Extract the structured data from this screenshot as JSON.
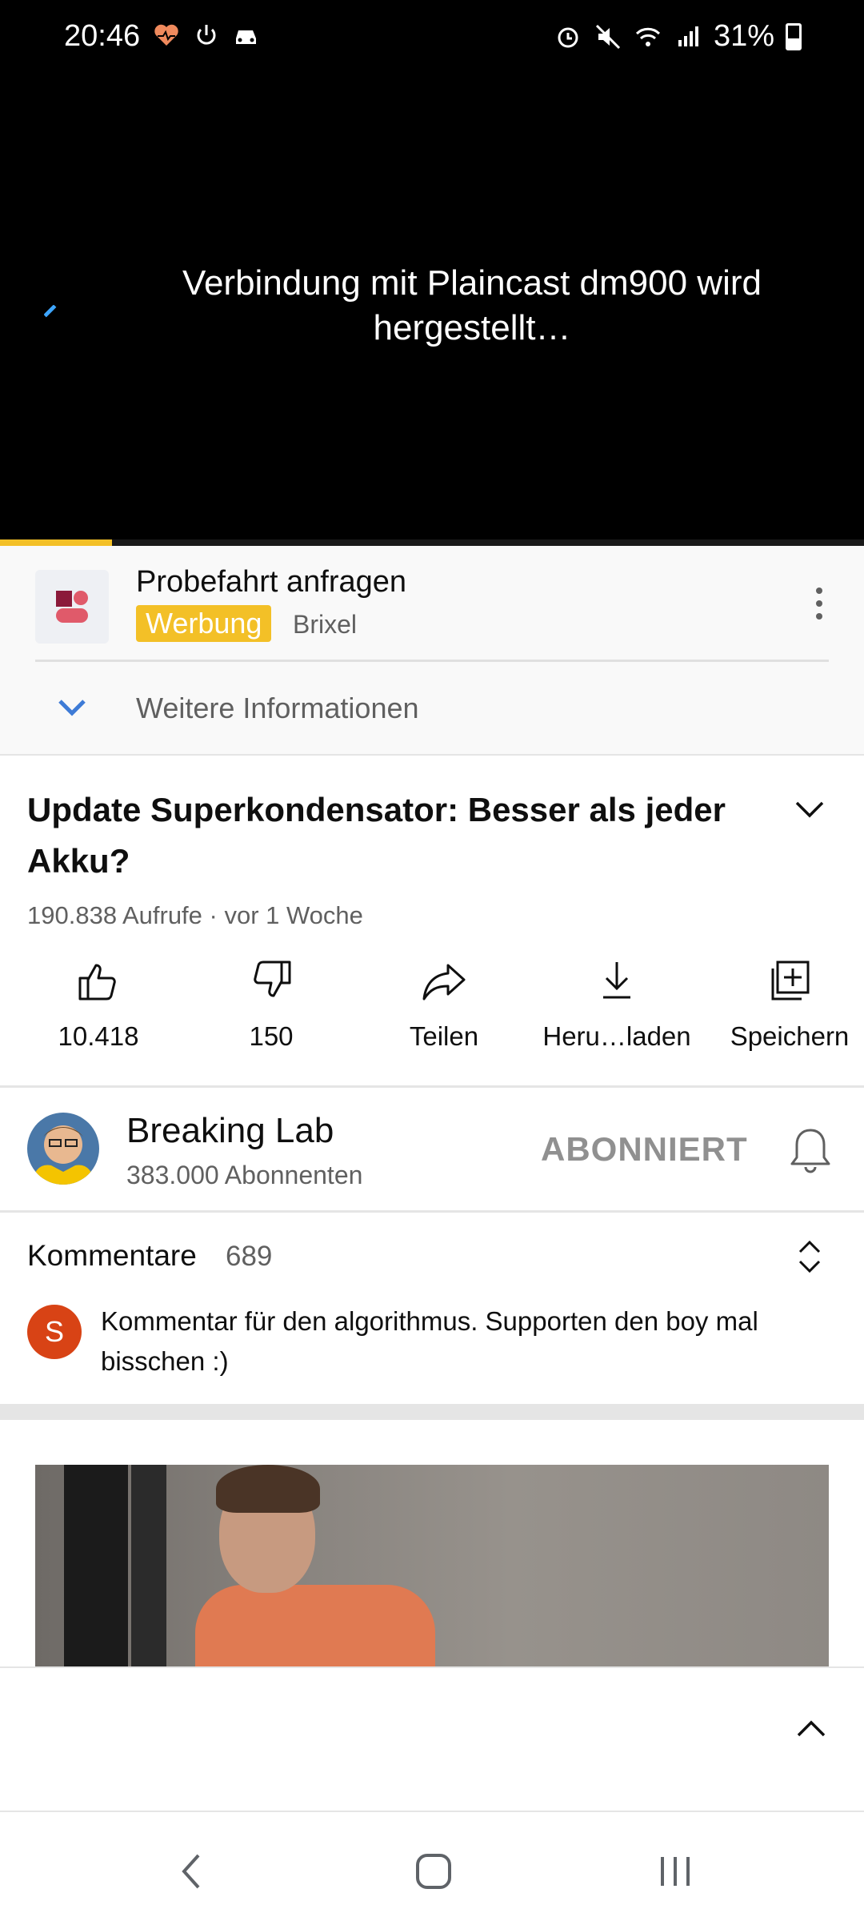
{
  "status_bar": {
    "time": "20:46",
    "battery": "31%",
    "left_icons": [
      "heart-rate-icon",
      "power-icon",
      "car-icon"
    ],
    "right_icons": [
      "alarm-icon",
      "mute-icon",
      "wifi-icon",
      "volte-icon",
      "signal-icon",
      "battery-icon"
    ]
  },
  "player": {
    "cast_message": "Verbindung mit Plaincast dm900 wird hergestellt…",
    "progress": 0.13,
    "progress_color": "#f3c027"
  },
  "ad": {
    "title": "Probefahrt anfragen",
    "badge": "Werbung",
    "advertiser": "Brixel",
    "more_info": "Weitere Informationen",
    "badge_color": "#f3c027"
  },
  "video": {
    "title": "Update Superkondensator: Besser als jeder Akku?",
    "meta": "190.838 Aufrufe · vor 1 Woche"
  },
  "actions": [
    {
      "icon": "thumbs-up-icon",
      "label": "10.418"
    },
    {
      "icon": "thumbs-down-icon",
      "label": "150"
    },
    {
      "icon": "share-icon",
      "label": "Teilen"
    },
    {
      "icon": "download-icon",
      "label": "Heru…laden"
    },
    {
      "icon": "save-to-playlist-icon",
      "label": "Speichern"
    }
  ],
  "channel": {
    "name": "Breaking Lab",
    "subscribers": "383.000 Abonnenten",
    "subscribe_label": "ABONNIERT"
  },
  "comments": {
    "title": "Kommentare",
    "count": "689",
    "first_avatar_letter": "S",
    "first_comment": "Kommentar für den algorithmus. Supporten den boy mal bisschen :)",
    "avatar_color": "#d84315"
  },
  "navbar": {
    "buttons": [
      "back-icon",
      "home-icon",
      "recents-icon"
    ]
  }
}
